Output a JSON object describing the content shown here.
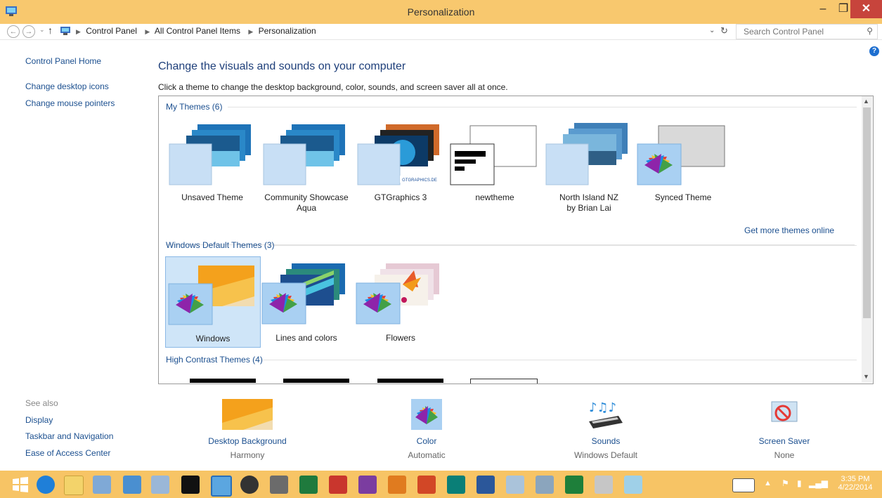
{
  "window": {
    "title": "Personalization",
    "minimize": "–",
    "maximize": "❐",
    "close": "✕"
  },
  "address": {
    "crumbs": [
      "Control Panel",
      "All Control Panel Items",
      "Personalization"
    ],
    "search_placeholder": "Search Control Panel"
  },
  "left_nav": {
    "links": [
      "Control Panel Home",
      "Change desktop icons",
      "Change mouse pointers"
    ]
  },
  "main": {
    "heading": "Change the visuals and sounds on your computer",
    "subheading": "Click a theme to change the desktop background, color, sounds, and screen saver all at once."
  },
  "themes": {
    "my_themes_label": "My Themes (6)",
    "my_themes": [
      "Unsaved Theme",
      "Community Showcase Aqua",
      "GTGraphics 3",
      "newtheme",
      "North Island NZ by Brian Lai",
      "Synced Theme"
    ],
    "gtgraphics_watermark": "GTGRAPHICS.DE",
    "get_more": "Get more themes online",
    "default_label": "Windows Default Themes (3)",
    "default_themes": [
      "Windows",
      "Lines and colors",
      "Flowers"
    ],
    "selected": "Windows",
    "high_contrast_label": "High Contrast Themes (4)"
  },
  "see_also": {
    "label": "See also",
    "links": [
      "Display",
      "Taskbar and Navigation",
      "Ease of Access Center"
    ]
  },
  "bottom": {
    "desktop_background": {
      "label": "Desktop Background",
      "value": "Harmony"
    },
    "color": {
      "label": "Color",
      "value": "Automatic"
    },
    "sounds": {
      "label": "Sounds",
      "value": "Windows Default"
    },
    "screen_saver": {
      "label": "Screen Saver",
      "value": "None"
    }
  },
  "taskbar": {
    "time": "3:35 PM",
    "date": "4/22/2014"
  },
  "colors": {
    "titlebar": "#f8c86e",
    "taskbar": "#f7c465",
    "link": "#1b4f8f",
    "close": "#c7443c"
  }
}
